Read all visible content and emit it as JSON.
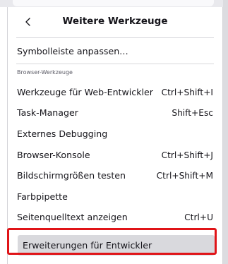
{
  "header": {
    "title": "Weitere Werkzeuge",
    "back_icon": "chevron-left-icon"
  },
  "menu": {
    "customize_toolbar": "Symbolleiste anpassen…",
    "section_label": "Browser-Werkzeuge",
    "items": [
      {
        "label": "Werkzeuge für Web-Entwickler",
        "shortcut": "Ctrl+Shift+I"
      },
      {
        "label": "Task-Manager",
        "shortcut": "Shift+Esc"
      },
      {
        "label": "Externes Debugging",
        "shortcut": ""
      },
      {
        "label": "Browser-Konsole",
        "shortcut": "Ctrl+Shift+J"
      },
      {
        "label": "Bildschirmgrößen testen",
        "shortcut": "Ctrl+Shift+M"
      },
      {
        "label": "Farbpipette",
        "shortcut": ""
      },
      {
        "label": "Seitenquelltext anzeigen",
        "shortcut": "Ctrl+U"
      },
      {
        "label": "Erweiterungen für Entwickler",
        "shortcut": ""
      }
    ],
    "highlighted_item": "Erweiterungen für Entwickler"
  },
  "colors": {
    "highlight_border": "#e01418",
    "hover_background": "#d9d9dd",
    "text": "#15141a"
  }
}
